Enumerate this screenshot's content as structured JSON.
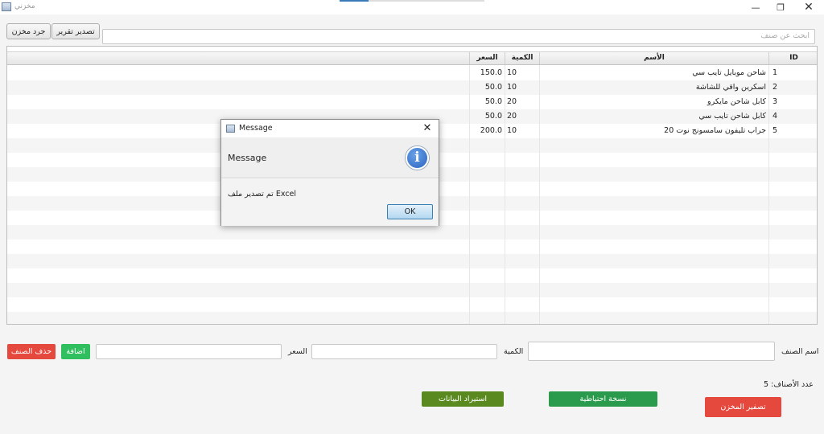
{
  "window": {
    "title": "مخزني"
  },
  "toolbar": {
    "export_report": "تصدير تقرير",
    "inventory_count": "جرد مخزن"
  },
  "search": {
    "placeholder": "ابحث عن صنف"
  },
  "table": {
    "headers": {
      "id": "ID",
      "name": "الأسم",
      "quantity": "الكمية",
      "price": "السعر"
    },
    "rows": [
      {
        "id": "1",
        "name": "شاحن موبايل تايب سي",
        "quantity": "10",
        "price": "150.0"
      },
      {
        "id": "2",
        "name": "اسكرين واقي للشاشة",
        "quantity": "10",
        "price": "50.0"
      },
      {
        "id": "3",
        "name": "كابل شاحن مايكرو",
        "quantity": "20",
        "price": "50.0"
      },
      {
        "id": "4",
        "name": "كابل شاحن تايب سي",
        "quantity": "20",
        "price": "50.0"
      },
      {
        "id": "5",
        "name": "جراب تليفون سامسونج نوت 20",
        "quantity": "10",
        "price": "200.0"
      }
    ]
  },
  "dialog": {
    "title": "Message",
    "header": "Message",
    "content": "تم تصدير ملف Excel",
    "ok": "OK"
  },
  "form": {
    "item_name_label": "اسم الصنف",
    "quantity_label": "الكمية",
    "price_label": "السعر",
    "add_button": "اضافة",
    "delete_button": "حذف الصنف"
  },
  "footer": {
    "item_count": "عدد الأصناف: 5",
    "reset_button": "تصفير المخزن",
    "backup_button": "نسخة احتياطية",
    "restore_button": "استيراد البيانات"
  },
  "colors": {
    "red": "#e5483d",
    "green": "#2fbf5f",
    "dark_green": "#2a9a4c",
    "olive": "#5a8a1f"
  }
}
